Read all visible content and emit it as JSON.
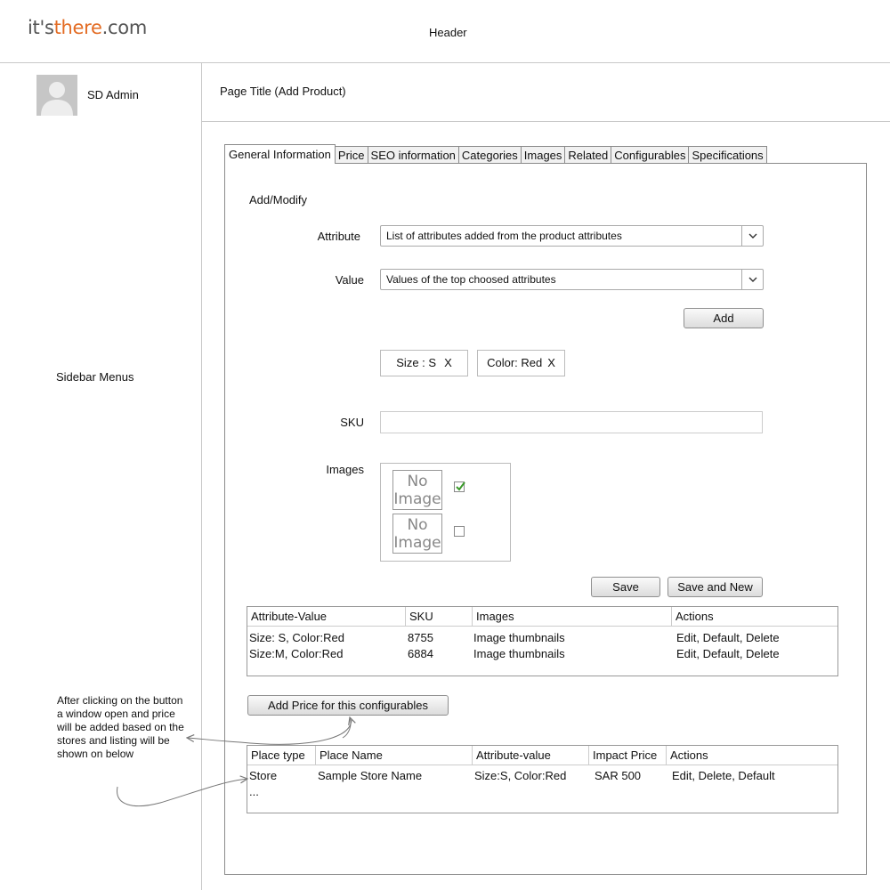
{
  "header": {
    "logo": {
      "part1": "it's",
      "part2": "there",
      "part3": ".com"
    },
    "label": "Header",
    "accent_color": "#e36c24"
  },
  "sidebar": {
    "avatar_icon": "user-avatar-icon",
    "admin_name": "SD Admin",
    "menus_label": "Sidebar Menus"
  },
  "page": {
    "title": "Page Title (Add Product)"
  },
  "tabs": [
    {
      "label": "General Information",
      "active": true
    },
    {
      "label": "Price"
    },
    {
      "label": "SEO information"
    },
    {
      "label": "Categories"
    },
    {
      "label": "Images"
    },
    {
      "label": "Related"
    },
    {
      "label": "Configurables"
    },
    {
      "label": "Specifications"
    }
  ],
  "form": {
    "section_title": "Add/Modify",
    "attribute": {
      "label": "Attribute",
      "value": "List of attributes added from the product attributes"
    },
    "value": {
      "label": "Value",
      "value": "Values of the top choosed attributes"
    },
    "add_button": "Add",
    "tags": [
      {
        "text": "Size : S",
        "remove": "X"
      },
      {
        "text": "Color: Red",
        "remove": "X"
      }
    ],
    "sku": {
      "label": "SKU",
      "value": ""
    },
    "images": {
      "label": "Images",
      "items": [
        {
          "placeholder": "No Image",
          "checked": true
        },
        {
          "placeholder": "No Image",
          "checked": false
        }
      ]
    },
    "save_button": "Save",
    "save_new_button": "Save and New"
  },
  "config_table": {
    "columns": [
      "Attribute-Value",
      "SKU",
      "Images",
      "Actions"
    ],
    "rows": [
      [
        "Size: S, Color:Red",
        "8755",
        "Image thumbnails",
        "Edit, Default, Delete"
      ],
      [
        "Size:M, Color:Red",
        "6884",
        "Image thumbnails",
        "Edit, Default, Delete"
      ]
    ]
  },
  "add_price_button": "Add Price for this configurables",
  "price_table": {
    "columns": [
      "Place type",
      "Place Name",
      "Attribute-value",
      "Impact Price",
      "Actions"
    ],
    "rows": [
      [
        "Store",
        "Sample Store Name",
        "Size:S, Color:Red",
        "SAR 500",
        "Edit, Delete, Default"
      ]
    ],
    "more": "..."
  },
  "annotation": {
    "text": "After clicking on the button a window  open and price will  be added based on the stores and listing will be shown on below"
  }
}
